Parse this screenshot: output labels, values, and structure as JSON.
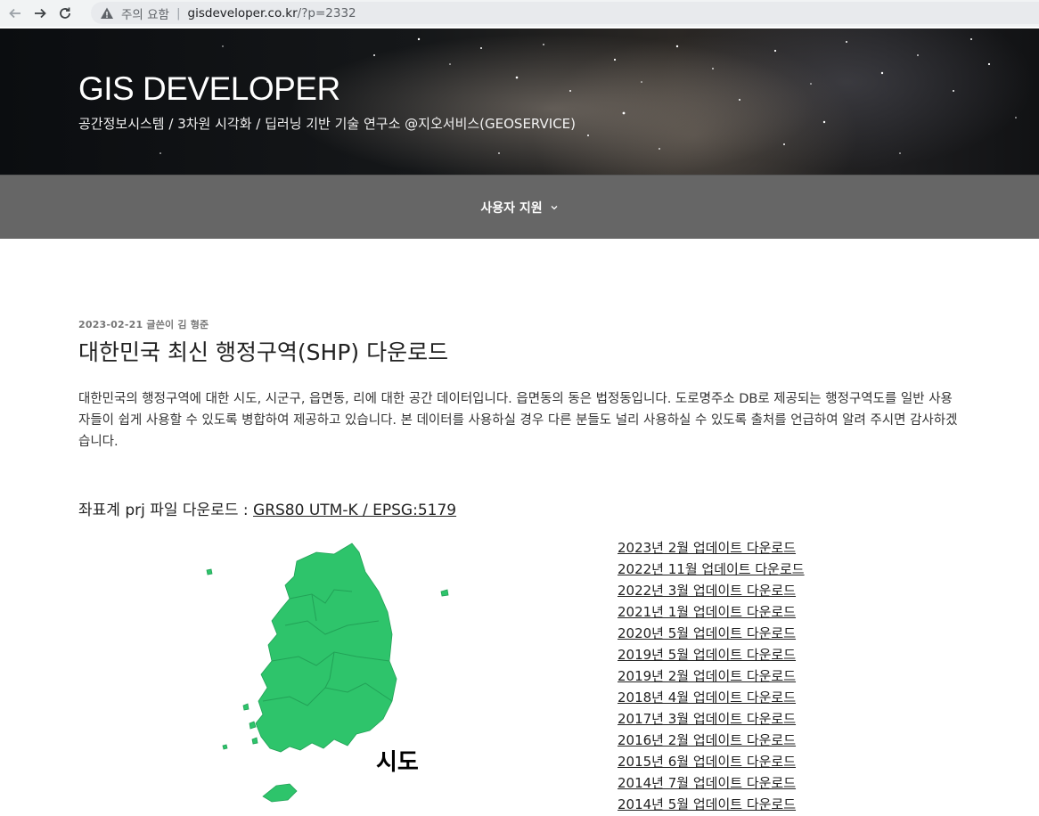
{
  "browser": {
    "warning": "주의 요함",
    "url_host": "gisdeveloper.co.kr",
    "url_path": "/?p=2332"
  },
  "header": {
    "title": "GIS DEVELOPER",
    "description": "공간정보시스템 / 3차원 시각화 / 딥러닝 기반 기술 연구소 @지오서비스(GEOSERVICE)"
  },
  "nav": {
    "items": [
      {
        "label": "사용자 지원",
        "icon": "chevron-down-icon"
      }
    ]
  },
  "post": {
    "meta": "2023-02-21 글쓴이 김 형준",
    "title": "대한민국 최신 행정구역(SHP) 다운로드",
    "intro": "대한민국의 행정구역에 대한 시도, 시군구, 읍면동, 리에 대한 공간 데이터입니다. 읍면동의 동은 법정동입니다. 도로명주소 DB로 제공되는 행정구역도를 일반 사용자들이 쉽게 사용할 수 있도록 병합하여 제공하고 있습니다. 본 데이터를 사용하실 경우 다른 분들도 널리 사용하실 수 있도록 출처를 언급하여 알려 주시면 감사하겠습니다.",
    "prj_label": "좌표계 prj 파일 다운로드 : ",
    "prj_link": "GRS80 UTM-K / EPSG:5179",
    "map_label": "시도",
    "downloads": [
      "2023년 2월 업데이트 다운로드",
      "2022년 11월 업데이트 다운로드",
      "2022년 3월 업데이트 다운로드",
      "2021년 1월 업데이트 다운로드",
      "2020년 5월 업데이트 다운로드",
      "2019년 5월 업데이트 다운로드",
      "2019년 2월 업데이트 다운로드",
      "2018년 4월 업데이트 다운로드",
      "2017년 3월 업데이트 다운로드",
      "2016년 2월 업데이트 다운로드",
      "2015년 6월 업데이트 다운로드",
      "2014년 7월 업데이트 다운로드",
      "2014년 5월 업데이트 다운로드"
    ]
  },
  "colors": {
    "map_fill": "#2ec46b",
    "nav_bg": "#666666"
  }
}
